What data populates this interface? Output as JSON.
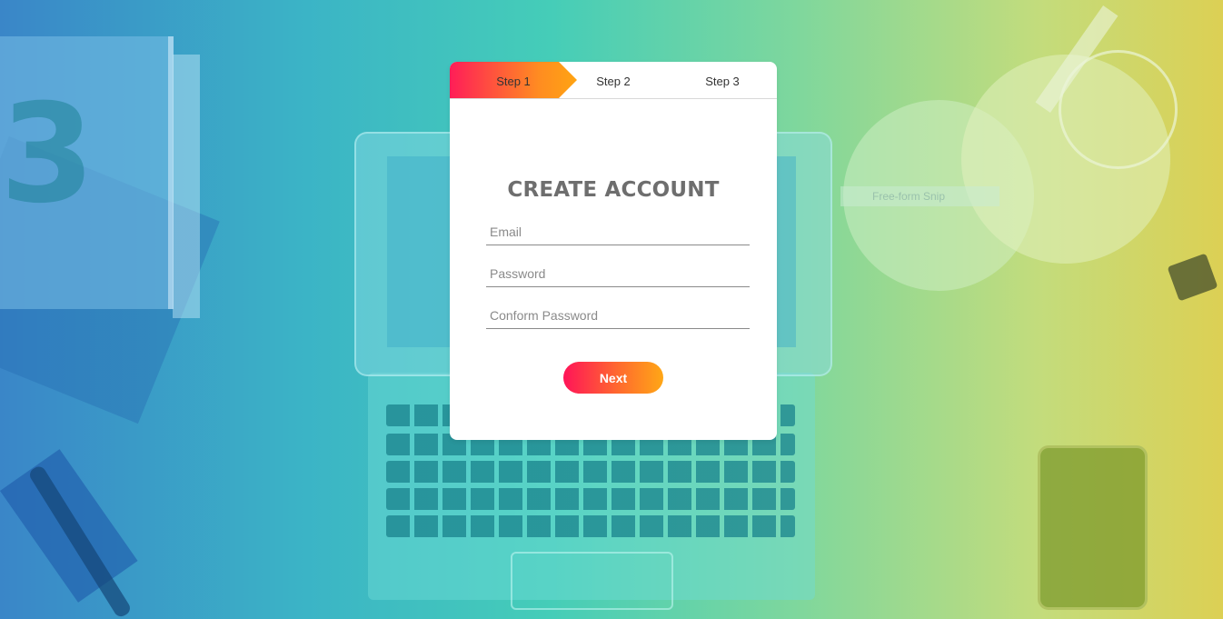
{
  "steps": [
    {
      "label": "Step 1",
      "active": true
    },
    {
      "label": "Step 2",
      "active": false
    },
    {
      "label": "Step 3",
      "active": false
    }
  ],
  "form": {
    "title": "CREATE ACCOUNT",
    "email_placeholder": "Email",
    "email_value": "",
    "password_placeholder": "Password",
    "password_value": "",
    "confirm_placeholder": "Conform Password",
    "confirm_value": "",
    "next_label": "Next"
  },
  "background": {
    "snip_label": "Free-form Snip"
  },
  "colors": {
    "accent_start": "#ff1d58",
    "accent_end": "#ffa412",
    "title": "#6e6e6e"
  }
}
